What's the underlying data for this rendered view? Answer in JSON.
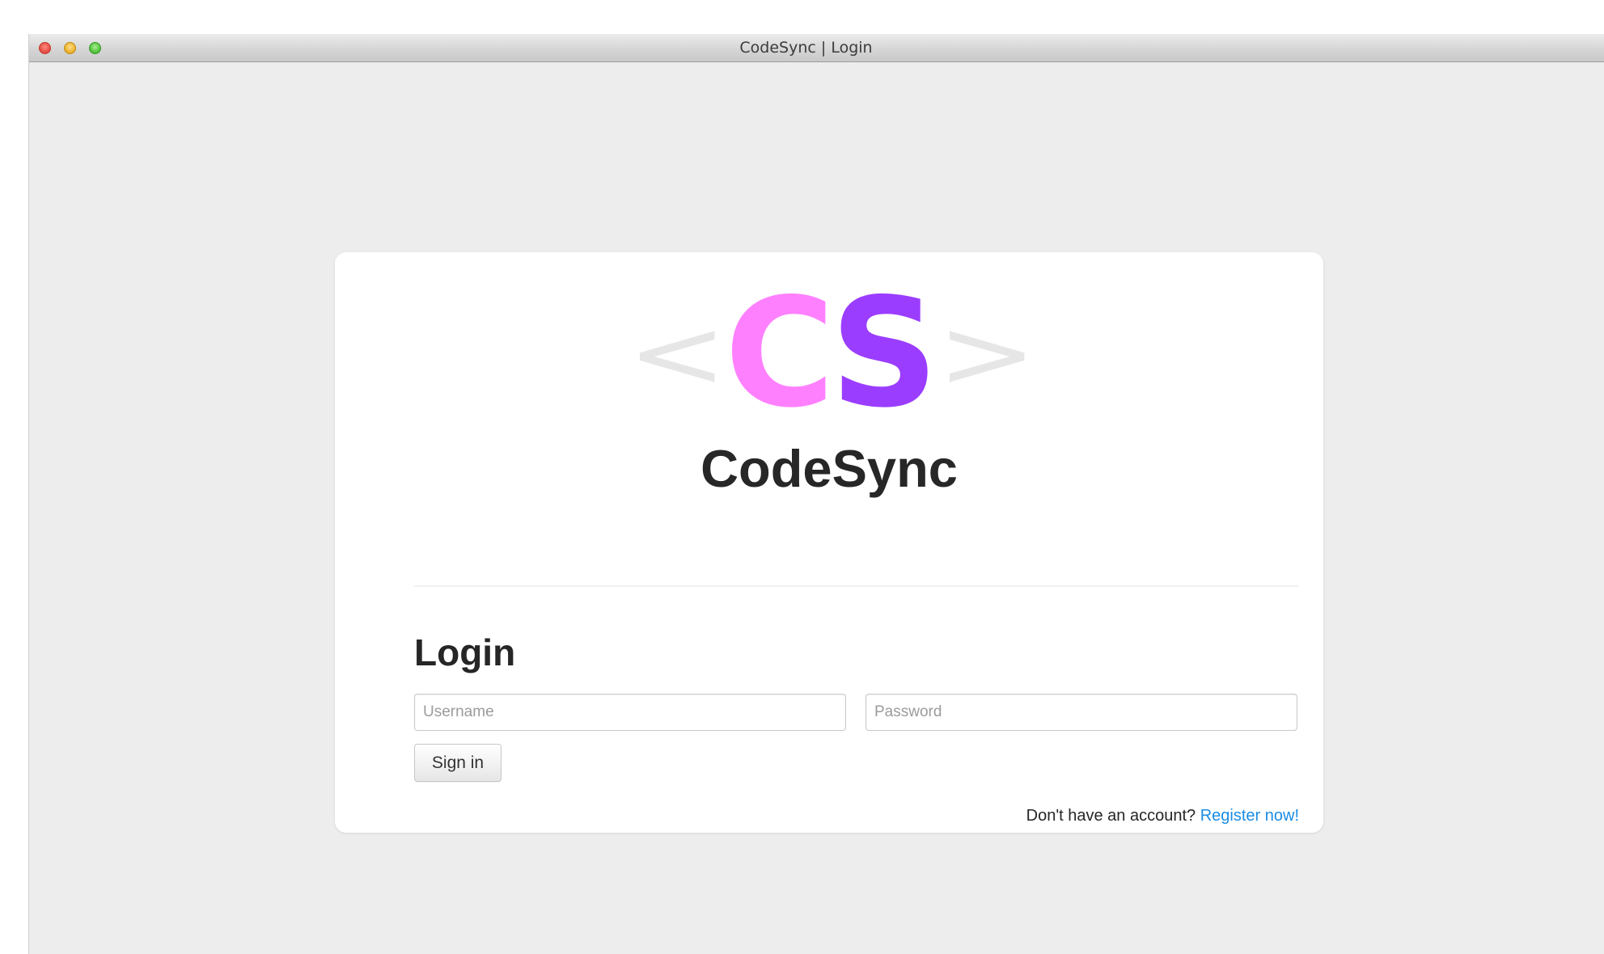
{
  "window": {
    "title": "CodeSync | Login"
  },
  "logo": {
    "left_bracket": "<",
    "letter_c": "C",
    "letter_s": "S",
    "right_bracket": ">",
    "colors": {
      "bracket": "#e6e6e6",
      "c": "#ff80ff",
      "s": "#9b3dff"
    }
  },
  "brand_name": "CodeSync",
  "login": {
    "heading": "Login",
    "username_placeholder": "Username",
    "password_placeholder": "Password",
    "username_value": "",
    "password_value": "",
    "sign_in_label": "Sign in",
    "register_prompt": "Don't have an account?",
    "register_link": "Register now!"
  },
  "colors": {
    "link": "#1a8ce3"
  }
}
